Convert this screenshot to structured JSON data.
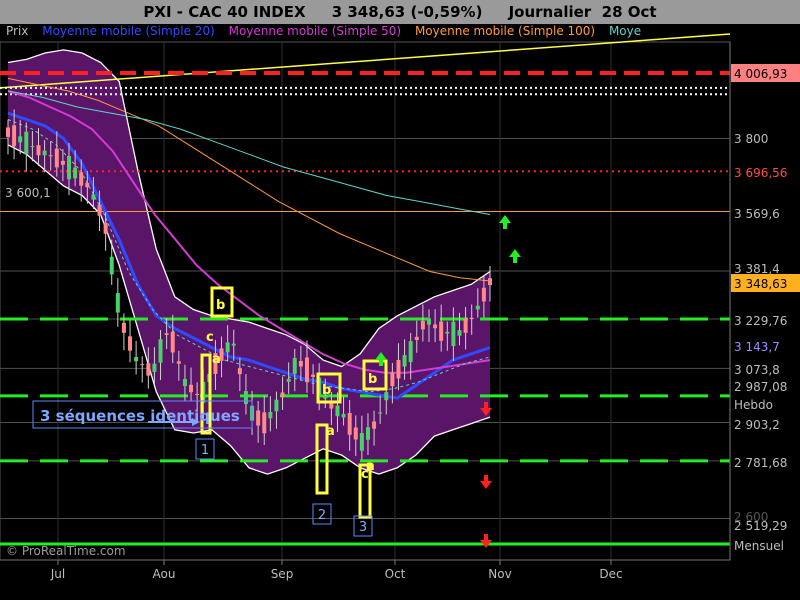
{
  "header": {
    "title": "PXI - CAC 40 INDEX",
    "price": "3 348,63 (-0,59%)",
    "period": "Journalier",
    "date": "28 Oct"
  },
  "legend": [
    {
      "label": "Prix",
      "color": "#bdbdbd"
    },
    {
      "label": "Moyenne mobile (Simple 20)",
      "color": "#2f4bff"
    },
    {
      "label": "Moyenne mobile (Simple 50)",
      "color": "#d43bd4"
    },
    {
      "label": "Moyenne mobile (Simple 100)",
      "color": "#ff9a3c"
    },
    {
      "label": "Moye",
      "color": "#5fd4c8"
    }
  ],
  "watermark": "© ProRealTime.com",
  "annotations": {
    "sequences": "3 séquences identiques",
    "n1": "1",
    "n2": "2",
    "n3": "3",
    "a": "a",
    "b": "b",
    "c": "c"
  },
  "price_labels": [
    {
      "text": "4 006,93",
      "bg": "#ff8080",
      "fg": "#000000"
    },
    {
      "text": "3 800",
      "bg": "",
      "fg": "#bdbdbd"
    },
    {
      "text": "3 696,56",
      "bg": "",
      "fg": "#ff4a4a"
    },
    {
      "text": "3 569,6",
      "bg": "",
      "fg": "#bdbdbd"
    },
    {
      "text": "3 381,4",
      "bg": "",
      "fg": "#bdbdbd"
    },
    {
      "text": "3 348,63",
      "bg": "#ffb01e",
      "fg": "#000000"
    },
    {
      "text": "3 229,76",
      "bg": "",
      "fg": "#bdbdbd"
    },
    {
      "text": "3 143,7",
      "bg": "",
      "fg": "#9b8fff"
    },
    {
      "text": "3 073,8",
      "bg": "",
      "fg": "#bdbdbd"
    },
    {
      "text": "2 987,08",
      "bg": "",
      "fg": "#bdbdbd"
    },
    {
      "text": "Hebdo",
      "bg": "",
      "fg": "#bdbdbd"
    },
    {
      "text": "2 903,2",
      "bg": "",
      "fg": "#bdbdbd"
    },
    {
      "text": "2 781,68",
      "bg": "",
      "fg": "#bdbdbd"
    },
    {
      "text": "2 600",
      "bg": "",
      "fg": "#555555"
    },
    {
      "text": "2 519,29",
      "bg": "",
      "fg": "#bdbdbd"
    },
    {
      "text": "Mensuel",
      "bg": "",
      "fg": "#bdbdbd"
    }
  ],
  "left_label": "3 600,1",
  "chart_data": {
    "type": "line",
    "title": "PXI - CAC 40 INDEX",
    "xlabels": [
      "Jul",
      "Aou",
      "Sep",
      "Oct",
      "Nov",
      "Dec"
    ],
    "ylim": [
      2500,
      4100
    ],
    "levels": [
      {
        "name": "",
        "value": 4006.93,
        "style": "red-dashed"
      },
      {
        "name": "",
        "value": 3696.56,
        "style": "red-dotted"
      },
      {
        "name": "",
        "value": 3229.76,
        "style": "green-dashed"
      },
      {
        "name": "Hebdo",
        "value": 2987.08,
        "style": "green-dashed"
      },
      {
        "name": "",
        "value": 2781.68,
        "style": "green-dashed"
      },
      {
        "name": "Mensuel",
        "value": 2519.29,
        "style": "green-solid"
      }
    ],
    "last_price": 3348.63,
    "series": [
      {
        "name": "Prix",
        "values": [
          3820,
          3790,
          3760,
          3740,
          3700,
          3650,
          3540,
          3230,
          3100,
          3060,
          3200,
          3030,
          2980,
          3100,
          3160,
          2940,
          2900,
          2980,
          3100,
          3050,
          2960,
          2920,
          2840,
          2910,
          3050,
          3120,
          3230,
          3190,
          3180,
          3240,
          3348
        ]
      },
      {
        "name": "Moyenne mobile (Simple 20)",
        "values": [
          3880,
          3860,
          3840,
          3800,
          3720,
          3600,
          3480,
          3340,
          3240,
          3200,
          3170,
          3140,
          3110,
          3100,
          3080,
          3060,
          3040,
          3030,
          3010,
          3000,
          2990,
          2980,
          3020,
          3060,
          3100,
          3120,
          3140
        ]
      },
      {
        "name": "Moyenne mobile (Simple 50)",
        "values": [
          3950,
          3930,
          3900,
          3870,
          3830,
          3760,
          3660,
          3560,
          3480,
          3400,
          3340,
          3290,
          3240,
          3200,
          3160,
          3120,
          3090,
          3070,
          3060,
          3060,
          3070,
          3080,
          3090,
          3100
        ]
      },
      {
        "name": "Moyenne mobile (Simple 100)",
        "values": [
          3990,
          3970,
          3950,
          3920,
          3880,
          3840,
          3780,
          3720,
          3660,
          3600,
          3550,
          3500,
          3460,
          3420,
          3380,
          3360,
          3350
        ]
      }
    ]
  }
}
